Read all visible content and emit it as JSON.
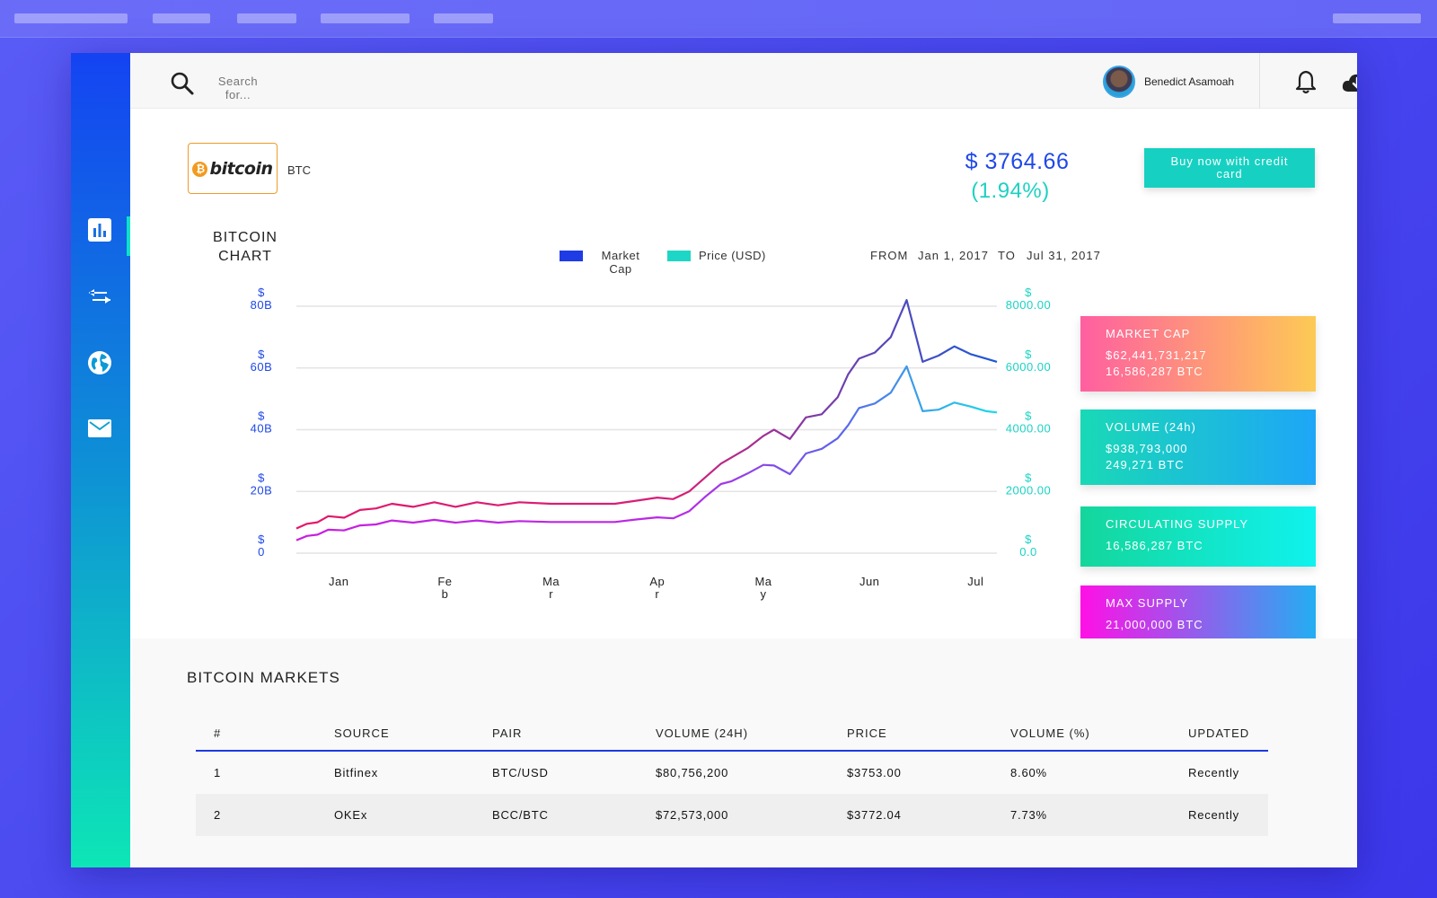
{
  "header": {
    "search_placeholder": "Search for...",
    "user_name": "Benedict Asamoah"
  },
  "sidebar": {
    "items": [
      {
        "icon": "bar-chart-icon"
      },
      {
        "icon": "swap-arrows-icon"
      },
      {
        "icon": "globe-icon"
      },
      {
        "icon": "mail-icon"
      }
    ]
  },
  "coin": {
    "logo_text": "bitcoin",
    "ticker": "BTC",
    "price": "$ 3764.66",
    "change": "(1.94%)",
    "buy_label": "Buy now with credit card"
  },
  "chart": {
    "title": "BITCOIN CHART",
    "legend_market_cap": "Market Cap",
    "legend_price": "Price (USD)",
    "from_label": "FROM",
    "from_date": "Jan 1, 2017",
    "to_label": "TO",
    "to_date": "Jul 31, 2017"
  },
  "chart_data": {
    "type": "line",
    "title": "BITCOIN CHART",
    "x_ticks": [
      "Jan",
      "Feb",
      "Mar",
      "Apr",
      "May",
      "Jun",
      "Jul"
    ],
    "y_left_ticks": [
      "$ 0",
      "$ 20B",
      "$ 40B",
      "$ 60B",
      "$ 80B"
    ],
    "y_right_ticks": [
      "$ 0.0",
      "$ 2000.00",
      "$ 4000.00",
      "$ 6000.00",
      "$ 8000.00"
    ],
    "ylim_left": [
      0,
      80
    ],
    "ylim_right": [
      0,
      8000
    ],
    "xlim": [
      0,
      6.6
    ],
    "grid": true,
    "series": [
      {
        "name": "Market Cap",
        "axis": "left",
        "unit": "B",
        "x": [
          0,
          0.1,
          0.2,
          0.3,
          0.45,
          0.6,
          0.75,
          0.9,
          1.1,
          1.3,
          1.5,
          1.7,
          1.9,
          2.1,
          2.4,
          2.7,
          3.0,
          3.2,
          3.4,
          3.55,
          3.7,
          3.85,
          4.0,
          4.1,
          4.25,
          4.4,
          4.5,
          4.65,
          4.8,
          4.95,
          5.1,
          5.2,
          5.3,
          5.45,
          5.6,
          5.75,
          5.9,
          6.05,
          6.2,
          6.35,
          6.5,
          6.6
        ],
        "values": [
          8,
          9.5,
          10,
          12,
          11.5,
          14,
          14.5,
          16,
          15,
          16.5,
          15,
          16.5,
          15.5,
          16.5,
          16,
          16,
          16,
          17,
          18,
          17.5,
          20,
          24.5,
          29,
          31,
          34,
          38,
          40,
          37,
          44,
          45,
          50.5,
          58,
          63,
          65,
          70,
          82,
          62,
          64,
          67,
          64.5,
          63,
          62
        ]
      },
      {
        "name": "Price (USD)",
        "axis": "right",
        "x": [
          0,
          0.1,
          0.2,
          0.3,
          0.45,
          0.6,
          0.75,
          0.9,
          1.1,
          1.3,
          1.5,
          1.7,
          1.9,
          2.1,
          2.4,
          2.7,
          3.0,
          3.2,
          3.4,
          3.55,
          3.7,
          3.85,
          4.0,
          4.1,
          4.25,
          4.4,
          4.5,
          4.65,
          4.8,
          4.95,
          5.1,
          5.2,
          5.3,
          5.45,
          5.6,
          5.75,
          5.9,
          6.05,
          6.2,
          6.35,
          6.5,
          6.6
        ],
        "values": [
          420,
          560,
          600,
          760,
          740,
          900,
          930,
          1060,
          990,
          1080,
          990,
          1060,
          990,
          1040,
          1010,
          1010,
          1010,
          1090,
          1160,
          1130,
          1360,
          1820,
          2240,
          2330,
          2580,
          2860,
          2840,
          2560,
          3230,
          3380,
          3720,
          4150,
          4700,
          4850,
          5200,
          6050,
          4600,
          4650,
          4880,
          4750,
          4600,
          4560
        ]
      }
    ]
  },
  "stats": [
    {
      "title": "MARKET CAP",
      "lines": [
        "$62,441,731,217",
        "16,586,287 BTC"
      ],
      "colors": [
        "#ff5fa0",
        "#fdca55"
      ]
    },
    {
      "title": "VOLUME (24h)",
      "lines": [
        "$938,793,000",
        "249,271 BTC"
      ],
      "colors": [
        "#19d9b6",
        "#1ea6f7"
      ]
    },
    {
      "title": "CIRCULATING SUPPLY",
      "lines": [
        "16,586,287 BTC"
      ],
      "colors": [
        "#14d69c",
        "#10f2ee"
      ]
    },
    {
      "title": "MAX SUPPLY",
      "lines": [
        "21,000,000 BTC"
      ],
      "colors": [
        "#ff10e6",
        "#23aef2"
      ]
    }
  ],
  "markets": {
    "title": "BITCOIN MARKETS",
    "columns": [
      "#",
      "SOURCE",
      "PAIR",
      "VOLUME (24H)",
      "PRICE",
      "VOLUME (%)",
      "UPDATED"
    ],
    "rows": [
      [
        "1",
        "Bitfinex",
        "BTC/USD",
        "$80,756,200",
        "$3753.00",
        "8.60%",
        "Recently"
      ],
      [
        "2",
        "OKEx",
        "BCC/BTC",
        "$72,573,000",
        "$3772.04",
        "7.73%",
        "Recently"
      ]
    ]
  },
  "colors": {
    "accent_blue": "#1f48e8",
    "accent_teal": "#16d1c2",
    "market_cap_legend": "#1e3be6",
    "price_legend": "#1ed6c6"
  }
}
